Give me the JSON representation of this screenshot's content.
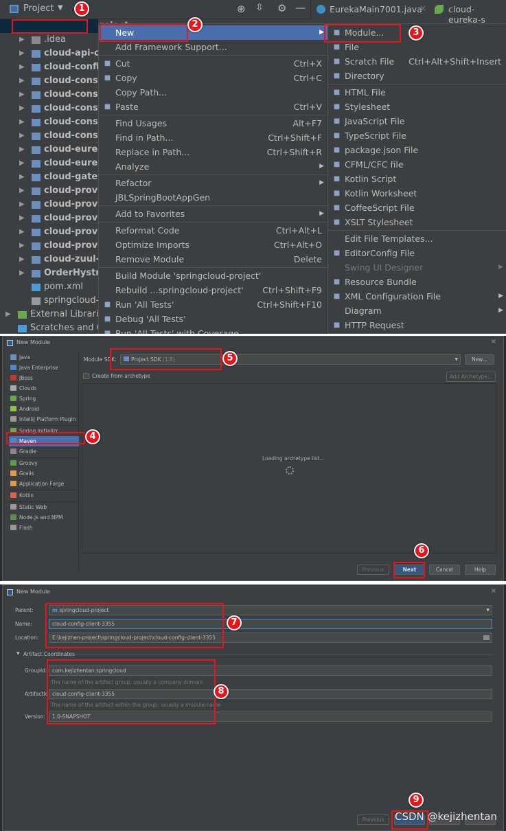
{
  "ide": {
    "project_label": "Project",
    "tabs": [
      "EurekaMain7001.java",
      "cloud-eureka-s"
    ],
    "tree": [
      {
        "label": "springcloud-project",
        "type": "module",
        "expanded": true
      },
      {
        "label": ".idea",
        "type": "folder"
      },
      {
        "label": "cloud-api-com",
        "type": "module"
      },
      {
        "label": "cloud-config",
        "type": "module"
      },
      {
        "label": "cloud-consu",
        "type": "module"
      },
      {
        "label": "cloud-consu",
        "type": "module"
      },
      {
        "label": "cloud-consu",
        "type": "module"
      },
      {
        "label": "cloud-consu",
        "type": "module"
      },
      {
        "label": "cloud-consu",
        "type": "module"
      },
      {
        "label": "cloud-eureka",
        "type": "module"
      },
      {
        "label": "cloud-eureka",
        "type": "module"
      },
      {
        "label": "cloud-gatewa",
        "type": "module"
      },
      {
        "label": "cloud-provid",
        "type": "module"
      },
      {
        "label": "cloud-provid",
        "type": "module"
      },
      {
        "label": "cloud-provid",
        "type": "module"
      },
      {
        "label": "cloud-provid",
        "type": "module"
      },
      {
        "label": "cloud-provid",
        "type": "module"
      },
      {
        "label": "cloud-zuul-g",
        "type": "module"
      },
      {
        "label": "OrderHystrix",
        "type": "module"
      },
      {
        "label": "pom.xml",
        "type": "maven-file"
      },
      {
        "label": "springcloud-p",
        "type": "iml-file"
      },
      {
        "label": "External Libraries",
        "type": "libraries"
      },
      {
        "label": "Scratches and Co",
        "type": "scratches"
      }
    ],
    "context_menu": [
      {
        "label": "New",
        "submenu": true,
        "highlight": true
      },
      {
        "label": "Add Framework Support..."
      },
      {
        "sep": true
      },
      {
        "label": "Cut",
        "shortcut": "Ctrl+X",
        "icon": "scissors-icon"
      },
      {
        "label": "Copy",
        "shortcut": "Ctrl+C",
        "icon": "copy-icon"
      },
      {
        "label": "Copy Path..."
      },
      {
        "label": "Paste",
        "shortcut": "Ctrl+V",
        "icon": "paste-icon"
      },
      {
        "sep": true
      },
      {
        "label": "Find Usages",
        "shortcut": "Alt+F7"
      },
      {
        "label": "Find in Path...",
        "shortcut": "Ctrl+Shift+F"
      },
      {
        "label": "Replace in Path...",
        "shortcut": "Ctrl+Shift+R"
      },
      {
        "label": "Analyze",
        "submenu": true
      },
      {
        "sep": true
      },
      {
        "label": "Refactor",
        "submenu": true
      },
      {
        "label": "JBLSpringBootAppGen"
      },
      {
        "sep": true
      },
      {
        "label": "Add to Favorites",
        "submenu": true
      },
      {
        "sep": true
      },
      {
        "label": "Reformat Code",
        "shortcut": "Ctrl+Alt+L"
      },
      {
        "label": "Optimize Imports",
        "shortcut": "Ctrl+Alt+O"
      },
      {
        "label": "Remove Module",
        "shortcut": "Delete"
      },
      {
        "sep": true
      },
      {
        "label": "Build Module 'springcloud-project'"
      },
      {
        "label": "Rebuild ...springcloud-project'",
        "shortcut": "Ctrl+Shift+F9"
      },
      {
        "label": "Run 'All Tests'",
        "shortcut": "Ctrl+Shift+F10",
        "icon": "run-icon"
      },
      {
        "label": "Debug 'All Tests'",
        "icon": "debug-icon"
      },
      {
        "label": "Run 'All Tests' with Coverage",
        "icon": "coverage-icon"
      }
    ],
    "new_submenu": [
      {
        "label": "Module...",
        "icon": "module-icon"
      },
      {
        "label": "File",
        "icon": "file-icon"
      },
      {
        "label": "Scratch File",
        "shortcut": "Ctrl+Alt+Shift+Insert",
        "icon": "scratch-icon"
      },
      {
        "label": "Directory",
        "icon": "folder-icon"
      },
      {
        "sep": true
      },
      {
        "label": "HTML File",
        "icon": "html-icon"
      },
      {
        "label": "Stylesheet",
        "icon": "css-icon"
      },
      {
        "label": "JavaScript File",
        "icon": "js-icon"
      },
      {
        "label": "TypeScript File",
        "icon": "ts-icon"
      },
      {
        "label": "package.json File",
        "icon": "npm-icon"
      },
      {
        "label": "CFML/CFC file",
        "icon": "cfml-icon"
      },
      {
        "label": "Kotlin Script",
        "icon": "kotlin-icon"
      },
      {
        "label": "Kotlin Worksheet",
        "icon": "kotlin-icon"
      },
      {
        "label": "CoffeeScript File",
        "icon": "coffee-icon"
      },
      {
        "label": "XSLT Stylesheet",
        "icon": "xslt-icon"
      },
      {
        "sep": true
      },
      {
        "label": "Edit File Templates..."
      },
      {
        "label": "EditorConfig File",
        "icon": "gear-icon"
      },
      {
        "label": "Swing UI Designer",
        "submenu": true,
        "disabled": true
      },
      {
        "label": "Resource Bundle",
        "icon": "bundle-icon"
      },
      {
        "label": "XML Configuration File",
        "submenu": true,
        "icon": "xml-icon"
      },
      {
        "label": "Diagram",
        "submenu": true
      },
      {
        "label": "HTTP Request",
        "icon": "api-icon"
      }
    ]
  },
  "dialog1": {
    "title": "New Module",
    "types": [
      {
        "label": "Java",
        "color": "#6a8fbf"
      },
      {
        "label": "Java Enterprise",
        "color": "#4a88c7"
      },
      {
        "label": "JBoss",
        "color": "#c0392b"
      },
      {
        "label": "Clouds",
        "color": "#aaaaaa"
      },
      {
        "label": "Spring",
        "color": "#6aa84f"
      },
      {
        "label": "Android",
        "color": "#8bc34a"
      },
      {
        "label": "IntelliJ Platform Plugin",
        "color": "#999999"
      },
      {
        "sep": true
      },
      {
        "label": "Spring Initializr",
        "color": "#6aa84f"
      },
      {
        "label": "Maven",
        "color": "#4a88c7",
        "selected": true
      },
      {
        "label": "Gradle",
        "color": "#888888"
      },
      {
        "sep": true
      },
      {
        "label": "Groovy",
        "color": "#5a9e4a"
      },
      {
        "label": "Grails",
        "color": "#e39b4b"
      },
      {
        "label": "Application Forge",
        "color": "#e39b4b"
      },
      {
        "sep": true
      },
      {
        "label": "Kotlin",
        "color": "#e0604a"
      },
      {
        "sep": true
      },
      {
        "label": "Static Web",
        "color": "#999999"
      },
      {
        "label": "Node.js and NPM",
        "color": "#5a8e4a"
      },
      {
        "label": "Flash",
        "color": "#999999"
      }
    ],
    "sdk_label": "Module SDK:",
    "sdk_value": "Project SDK",
    "sdk_version": "(1.8)",
    "new_button": "New...",
    "archetype_checkbox": "Create from archetype",
    "archetype_checked": false,
    "add_archetype": "Add Archetype...",
    "loading": "Loading archetype list...",
    "buttons": {
      "previous": "Previous",
      "next": "Next",
      "cancel": "Cancel",
      "help": "Help"
    }
  },
  "dialog2": {
    "title": "New Module",
    "parent_label": "Parent:",
    "parent_value": "springcloud-project",
    "name_label": "Name:",
    "name_value": "cloud-config-client-3355",
    "location_label": "Location:",
    "location_value": "E:\\kejizhen-project\\springcloud-project\\cloud-config-client-3355",
    "section": "Artifact Coordinates",
    "groupid_label": "GroupId:",
    "groupid_value": "com.kejizhentan.springcloud",
    "groupid_hint": "The name of the artifact group, usually a company domain",
    "artifactid_label": "ArtifactId:",
    "artifactid_value": "cloud-config-client-3355",
    "artifactid_hint": "The name of the artifact within the group, usually a module name",
    "version_label": "Version:",
    "version_value": "1.0-SNAPSHOT",
    "buttons": {
      "previous": "Previous"
    }
  },
  "steps": [
    "1",
    "2",
    "3",
    "4",
    "5",
    "6",
    "7",
    "8",
    "9"
  ],
  "watermark": "CSDN @kejizhentan",
  "colors": {
    "annotation": "#e8141b",
    "selection": "#4b6eaf",
    "background": "#3c3f41"
  }
}
